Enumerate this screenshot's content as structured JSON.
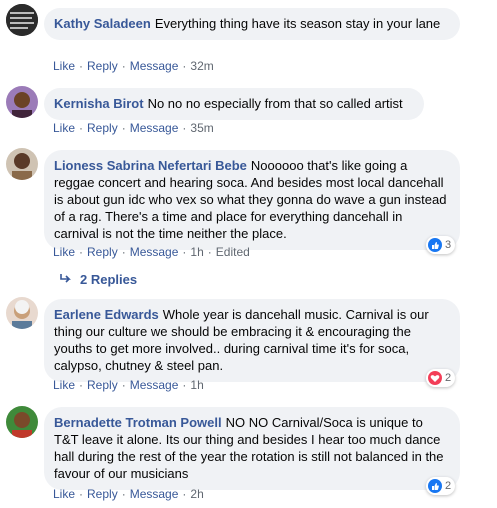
{
  "comments": [
    {
      "author": "Kathy Saladeen",
      "text": "Everything thing have its season stay in your lane",
      "actions": {
        "like": "Like",
        "reply": "Reply",
        "message": "Message",
        "time": "32m",
        "edited": ""
      },
      "reactions": null
    },
    {
      "author": "Kernisha Birot",
      "text": "No no no especially from that so called artist",
      "actions": {
        "like": "Like",
        "reply": "Reply",
        "message": "Message",
        "time": "35m",
        "edited": ""
      },
      "reactions": null
    },
    {
      "author": "Lioness Sabrina Nefertari Bebe",
      "text": "Noooooo that's like going a reggae concert and hearing soca. And besides most local dancehall is about gun idc who vex so what they gonna do wave a gun instead of a rag. There's a time and place for everything dancehall in carnival is not the time neither the place.",
      "actions": {
        "like": "Like",
        "reply": "Reply",
        "message": "Message",
        "time": "1h",
        "edited": "Edited"
      },
      "reactions": {
        "icon": "like-icon",
        "count": "3",
        "color": "#1877f2"
      }
    },
    {
      "author": "Earlene Edwards",
      "text": "Whole year is dancehall music. Carnival is our thing our culture we should be embracing it & encouraging the youths to get more involved.. during carnival time it's for soca, calypso, chutney & steel pan.",
      "actions": {
        "like": "Like",
        "reply": "Reply",
        "message": "Message",
        "time": "1h",
        "edited": ""
      },
      "reactions": {
        "icon": "love-icon",
        "count": "2",
        "color": "#f33e58"
      }
    },
    {
      "author": "Bernadette Trotman Powell",
      "text": "NO NO Carnival/Soca is unique to T&T leave it alone. Its our thing and besides I hear too much dance hall during the rest of the year the rotation is still not balanced in the favour of our musicians",
      "actions": {
        "like": "Like",
        "reply": "Reply",
        "message": "Message",
        "time": "2h",
        "edited": ""
      },
      "reactions": {
        "icon": "like-icon",
        "count": "2",
        "color": "#1877f2"
      }
    }
  ],
  "replies": {
    "icon": "reply-arrow-icon",
    "label": "2 Replies"
  }
}
